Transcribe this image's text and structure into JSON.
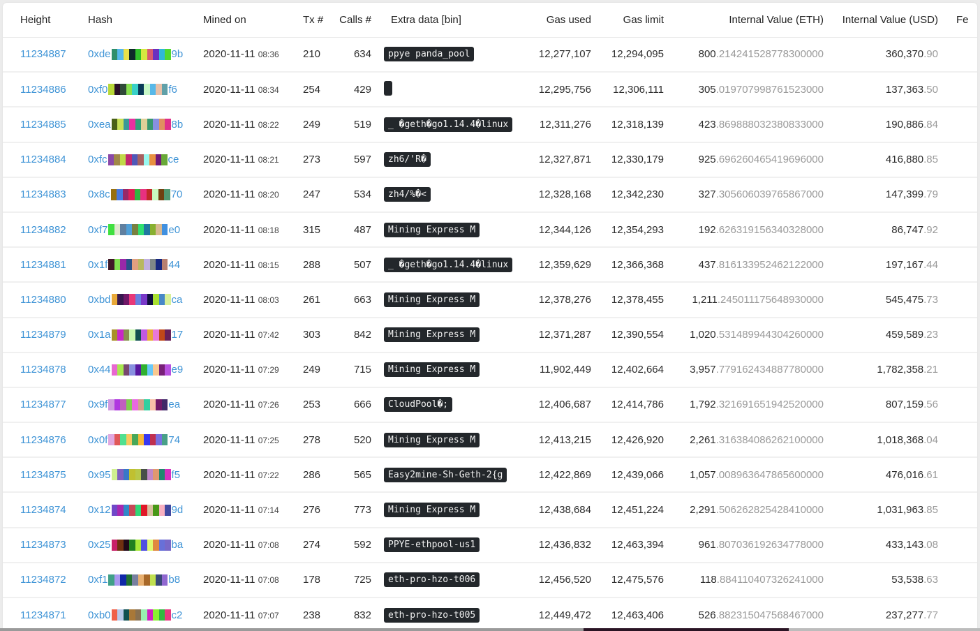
{
  "table": {
    "columns": [
      {
        "key": "height",
        "label": "Height"
      },
      {
        "key": "hash",
        "label": "Hash"
      },
      {
        "key": "mined_on",
        "label": "Mined on"
      },
      {
        "key": "tx",
        "label": "Tx #"
      },
      {
        "key": "calls",
        "label": "Calls #"
      },
      {
        "key": "extra",
        "label": "Extra data [bin]"
      },
      {
        "key": "gas_used",
        "label": "Gas used"
      },
      {
        "key": "gas_limit",
        "label": "Gas limit"
      },
      {
        "key": "eth_value",
        "label": "Internal Value (ETH)"
      },
      {
        "key": "usd_value",
        "label": "Internal Value (USD)"
      },
      {
        "key": "fee",
        "label": "Fe"
      }
    ],
    "rows": [
      {
        "height": "11234887",
        "hash_prefix": "0xde",
        "hash_suffix": "9b",
        "hash_colors": [
          "#2f8f6a",
          "#56b8ea",
          "#e8e04a",
          "#0f2a2a",
          "#30c02a",
          "#d6e840",
          "#d85a70",
          "#6a30c0",
          "#30b8d8",
          "#50d830"
        ],
        "date": "2020-11-11",
        "time": "08:36",
        "tx": "210",
        "calls": "634",
        "extra": "ppye panda_pool",
        "gas_used": "12,277,107",
        "gas_limit": "12,294,095",
        "eth_int": "800",
        "eth_dec": ".214241528778300000",
        "usd_int": "360,370",
        "usd_dec": ".90"
      },
      {
        "height": "11234886",
        "hash_prefix": "0xf0",
        "hash_suffix": "f6",
        "hash_colors": [
          "#b8d838",
          "#2a1028",
          "#2f4a38",
          "#88e050",
          "#38d0c8",
          "#0a3a58",
          "#c8f8c8",
          "#58b8e8",
          "#e8c0a8",
          "#60a0a8"
        ],
        "date": "2020-11-11",
        "time": "08:34",
        "tx": "254",
        "calls": "429",
        "extra": " ",
        "gas_used": "12,295,756",
        "gas_limit": "12,306,111",
        "eth_int": "305",
        "eth_dec": ".019707998761523000",
        "usd_int": "137,363",
        "usd_dec": ".50"
      },
      {
        "height": "11234885",
        "hash_prefix": "0xea",
        "hash_suffix": "8b",
        "hash_colors": [
          "#4a6018",
          "#c8e058",
          "#3a9898",
          "#e830a0",
          "#30a078",
          "#e0d098",
          "#389870",
          "#8890e0",
          "#e09060",
          "#e0308a"
        ],
        "date": "2020-11-11",
        "time": "08:22",
        "tx": "249",
        "calls": "519",
        "extra": "_ �geth�go1.14.4�linux",
        "gas_used": "12,311,276",
        "gas_limit": "12,318,139",
        "eth_int": "423",
        "eth_dec": ".869888032380833000",
        "usd_int": "190,886",
        "usd_dec": ".84"
      },
      {
        "height": "11234884",
        "hash_prefix": "0xfc",
        "hash_suffix": "ce",
        "hash_colors": [
          "#8a48a8",
          "#a08848",
          "#c0d848",
          "#c02870",
          "#5058b8",
          "#a86060",
          "#98f8f0",
          "#e89040",
          "#701878",
          "#68a838"
        ],
        "date": "2020-11-11",
        "time": "08:21",
        "tx": "273",
        "calls": "597",
        "extra": "zh6/'R�",
        "gas_used": "12,327,871",
        "gas_limit": "12,330,179",
        "eth_int": "925",
        "eth_dec": ".696260465419696000",
        "usd_int": "416,880",
        "usd_dec": ".85"
      },
      {
        "height": "11234883",
        "hash_prefix": "0x8c",
        "hash_suffix": "70",
        "hash_colors": [
          "#987010",
          "#4878e0",
          "#982868",
          "#e02058",
          "#30b840",
          "#e83080",
          "#c02828",
          "#c8f8c0",
          "#704010",
          "#509870"
        ],
        "date": "2020-11-11",
        "time": "08:20",
        "tx": "247",
        "calls": "534",
        "extra": "zh4/%�<",
        "gas_used": "12,328,168",
        "gas_limit": "12,342,230",
        "eth_int": "327",
        "eth_dec": ".305606039765867000",
        "usd_int": "147,399",
        "usd_dec": ".79"
      },
      {
        "height": "11234882",
        "hash_prefix": "0xf7",
        "hash_suffix": "e0",
        "hash_colors": [
          "#40e040",
          "#e0e8d0",
          "#6080a0",
          "#50a0d8",
          "#788040",
          "#30e070",
          "#2078a0",
          "#88b030",
          "#d8b890",
          "#4090e0"
        ],
        "date": "2020-11-11",
        "time": "08:18",
        "tx": "315",
        "calls": "487",
        "extra": "Mining Express M",
        "gas_used": "12,344,126",
        "gas_limit": "12,354,293",
        "eth_int": "192",
        "eth_dec": ".626319156340328000",
        "usd_int": "86,747",
        "usd_dec": ".92"
      },
      {
        "height": "11234881",
        "hash_prefix": "0x1f",
        "hash_suffix": "44",
        "hash_colors": [
          "#401828",
          "#80e050",
          "#9828a8",
          "#285088",
          "#e0a080",
          "#b8b860",
          "#c0b0e0",
          "#808888",
          "#182880",
          "#b88070"
        ],
        "date": "2020-11-11",
        "time": "08:15",
        "tx": "288",
        "calls": "507",
        "extra": "_ �geth�go1.14.4�linux",
        "gas_used": "12,359,629",
        "gas_limit": "12,366,368",
        "eth_int": "437",
        "eth_dec": ".816133952462122000",
        "usd_int": "197,167",
        "usd_dec": ".44"
      },
      {
        "height": "11234880",
        "hash_prefix": "0xbd",
        "hash_suffix": "ca",
        "hash_colors": [
          "#e8a838",
          "#381850",
          "#701868",
          "#e83878",
          "#6880e0",
          "#7838c8",
          "#101040",
          "#a8e030",
          "#4888c8",
          "#d8f098"
        ],
        "date": "2020-11-11",
        "time": "08:03",
        "tx": "261",
        "calls": "663",
        "extra": "Mining Express M",
        "gas_used": "12,378,276",
        "gas_limit": "12,378,455",
        "eth_int": "1,211",
        "eth_dec": ".245011175648930000",
        "usd_int": "545,475",
        "usd_dec": ".73"
      },
      {
        "height": "11234879",
        "hash_prefix": "0x1a",
        "hash_suffix": "17",
        "hash_colors": [
          "#a89028",
          "#c828c8",
          "#889050",
          "#c8f8b0",
          "#105050",
          "#c058e0",
          "#e8a838",
          "#e878d8",
          "#c04818",
          "#682058"
        ],
        "date": "2020-11-11",
        "time": "07:42",
        "tx": "303",
        "calls": "842",
        "extra": "Mining Express M",
        "gas_used": "12,371,287",
        "gas_limit": "12,390,554",
        "eth_int": "1,020",
        "eth_dec": ".531489944304260000",
        "usd_int": "459,589",
        "usd_dec": ".23"
      },
      {
        "height": "11234878",
        "hash_prefix": "0x44",
        "hash_suffix": "e9",
        "hash_colors": [
          "#e868d0",
          "#a8e850",
          "#784870",
          "#8890e0",
          "#5818a0",
          "#30b030",
          "#68c8f8",
          "#f8c890",
          "#782078",
          "#b850e0"
        ],
        "date": "2020-11-11",
        "time": "07:29",
        "tx": "249",
        "calls": "715",
        "extra": "Mining Express M",
        "gas_used": "11,902,449",
        "gas_limit": "12,402,664",
        "eth_int": "3,957",
        "eth_dec": ".779162434887780000",
        "usd_int": "1,782,358",
        "usd_dec": ".21"
      },
      {
        "height": "11234877",
        "hash_prefix": "0x9f",
        "hash_suffix": "ea",
        "hash_colors": [
          "#d098e0",
          "#b038e0",
          "#c060c0",
          "#80d050",
          "#e868e0",
          "#d0a088",
          "#30d0a0",
          "#f8c0a8",
          "#701868",
          "#402868"
        ],
        "date": "2020-11-11",
        "time": "07:26",
        "tx": "253",
        "calls": "666",
        "extra": "CloudPool�;",
        "gas_used": "12,406,687",
        "gas_limit": "12,414,786",
        "eth_int": "1,792",
        "eth_dec": ".321691651942520000",
        "usd_int": "807,159",
        "usd_dec": ".56"
      },
      {
        "height": "11234876",
        "hash_prefix": "0x0f",
        "hash_suffix": "74",
        "hash_colors": [
          "#e0a8e0",
          "#e05858",
          "#50e090",
          "#f8c860",
          "#48a858",
          "#f8b838",
          "#3838f0",
          "#c03050",
          "#7870e0",
          "#48a088"
        ],
        "date": "2020-11-11",
        "time": "07:25",
        "tx": "278",
        "calls": "520",
        "extra": "Mining Express M",
        "gas_used": "12,413,215",
        "gas_limit": "12,426,920",
        "eth_int": "2,261",
        "eth_dec": ".316384086262100000",
        "usd_int": "1,018,368",
        "usd_dec": ".04"
      },
      {
        "height": "11234875",
        "hash_prefix": "0x95",
        "hash_suffix": "f5",
        "hash_colors": [
          "#d0f090",
          "#8060c0",
          "#3878c8",
          "#c0c030",
          "#b8c848",
          "#485048",
          "#c088c8",
          "#e09870",
          "#208870",
          "#d830c0"
        ],
        "date": "2020-11-11",
        "time": "07:22",
        "tx": "286",
        "calls": "565",
        "extra": "Easy2mine-Sh-Geth-2{g",
        "gas_used": "12,422,869",
        "gas_limit": "12,439,066",
        "eth_int": "1,057",
        "eth_dec": ".008963647865600000",
        "usd_int": "476,016",
        "usd_dec": ".61"
      },
      {
        "height": "11234874",
        "hash_prefix": "0x12",
        "hash_suffix": "9d",
        "hash_colors": [
          "#7048c8",
          "#a828b0",
          "#3088c8",
          "#c84858",
          "#30d878",
          "#e01828",
          "#d8c0a0",
          "#489818",
          "#f8b0c0",
          "#4048a0"
        ],
        "date": "2020-11-11",
        "time": "07:14",
        "tx": "276",
        "calls": "773",
        "extra": "Mining Express M",
        "gas_used": "12,438,684",
        "gas_limit": "12,451,224",
        "eth_int": "2,291",
        "eth_dec": ".506262825428410000",
        "usd_int": "1,031,963",
        "usd_dec": ".85"
      },
      {
        "height": "11234873",
        "hash_prefix": "0x25",
        "hash_suffix": "ba",
        "hash_colors": [
          "#c82068",
          "#703010",
          "#200818",
          "#208020",
          "#a8e838",
          "#5050e0",
          "#e0f870",
          "#e08840",
          "#6870d8",
          "#7868c8"
        ],
        "date": "2020-11-11",
        "time": "07:08",
        "tx": "274",
        "calls": "592",
        "extra": "PPYE-ethpool-us1",
        "gas_used": "12,436,832",
        "gas_limit": "12,463,394",
        "eth_int": "961",
        "eth_dec": ".807036192634778000",
        "usd_int": "433,143",
        "usd_dec": ".08"
      },
      {
        "height": "11234872",
        "hash_prefix": "0xf1",
        "hash_suffix": "b8",
        "hash_colors": [
          "#40a088",
          "#a898f0",
          "#1028a8",
          "#207030",
          "#7880a0",
          "#e8b070",
          "#a86828",
          "#c0e050",
          "#384878",
          "#9068d0"
        ],
        "date": "2020-11-11",
        "time": "07:08",
        "tx": "178",
        "calls": "725",
        "extra": "eth-pro-hzo-t006",
        "gas_used": "12,456,520",
        "gas_limit": "12,475,576",
        "eth_int": "118",
        "eth_dec": ".884110407326241000",
        "usd_int": "53,538",
        "usd_dec": ".63"
      },
      {
        "height": "11234871",
        "hash_prefix": "0xb0",
        "hash_suffix": "c2",
        "hash_colors": [
          "#f06048",
          "#b8c8e8",
          "#105050",
          "#a87838",
          "#887050",
          "#98f0b0",
          "#d020c0",
          "#88f030",
          "#30b840",
          "#e83880"
        ],
        "date": "2020-11-11",
        "time": "07:07",
        "tx": "238",
        "calls": "832",
        "extra": "eth-pro-hzo-t005",
        "gas_used": "12,449,472",
        "gas_limit": "12,463,406",
        "eth_int": "526",
        "eth_dec": ".882315047568467000",
        "usd_int": "237,277",
        "usd_dec": ".77"
      }
    ]
  },
  "colors": {
    "link": "#3f94d6",
    "badge_bg": "#23272b",
    "decimal_gray": "#9a9a9a"
  }
}
